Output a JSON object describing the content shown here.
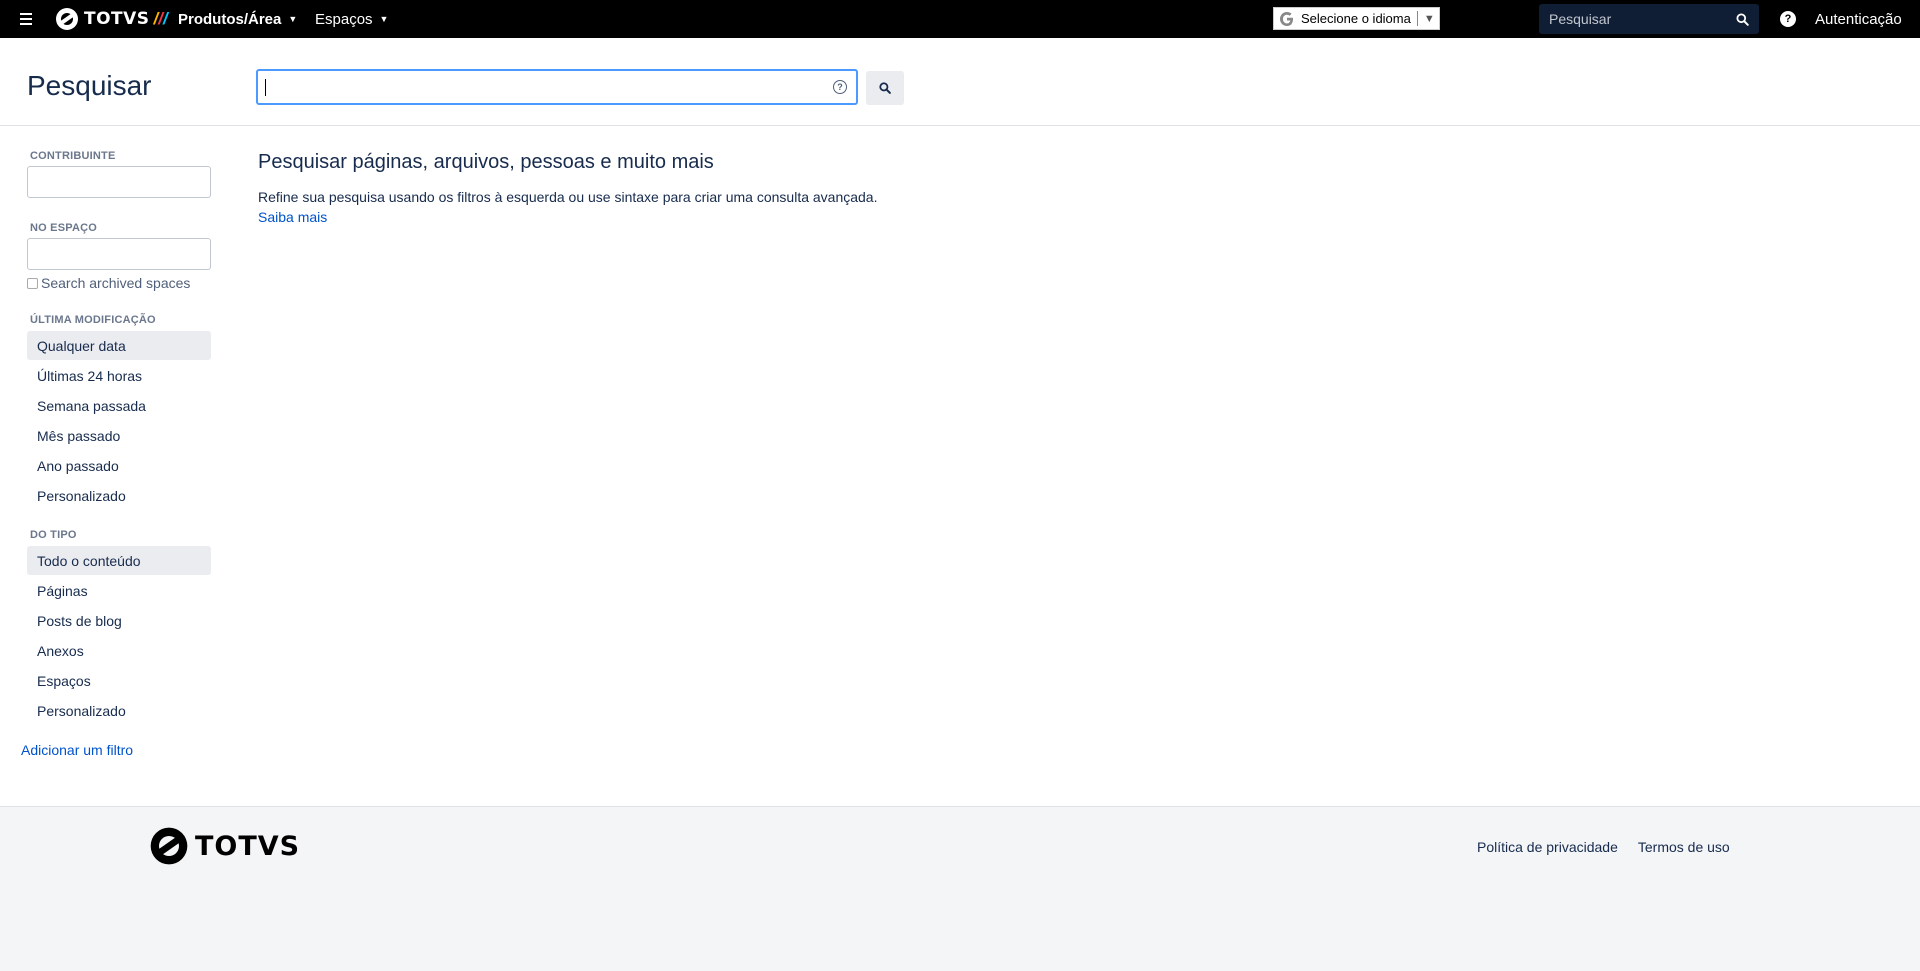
{
  "topbar": {
    "logo_text": "TOTVS",
    "nav_produtos": "Produtos/Área",
    "nav_espacos": "Espaços",
    "language_label": "Selecione o idioma",
    "search_placeholder": "Pesquisar",
    "login": "Autenticação"
  },
  "header": {
    "title": "Pesquisar",
    "search_value": ""
  },
  "sidebar": {
    "contributor_label": "CONTRIBUINTE",
    "space_label": "NO ESPAÇO",
    "archived_label": "Search archived spaces",
    "modified_label": "ÚLTIMA MODIFICAÇÃO",
    "modified_options": [
      "Qualquer data",
      "Últimas 24 horas",
      "Semana passada",
      "Mês passado",
      "Ano passado",
      "Personalizado"
    ],
    "type_label": "DO TIPO",
    "type_options": [
      "Todo o conteúdo",
      "Páginas",
      "Posts de blog",
      "Anexos",
      "Espaços",
      "Personalizado"
    ],
    "add_filter": "Adicionar um filtro"
  },
  "content": {
    "title": "Pesquisar páginas, arquivos, pessoas e muito mais",
    "description": "Refine sua pesquisa usando os filtros à esquerda ou use sintaxe para criar uma consulta avançada.",
    "learn_more": "Saiba mais"
  },
  "footer": {
    "logo_text": "TOTVS",
    "privacy": "Política de privacidade",
    "terms": "Termos de uso"
  },
  "colors": {
    "topbar": "#000000",
    "accent": "#0052cc",
    "focus": "#4c9aff"
  }
}
